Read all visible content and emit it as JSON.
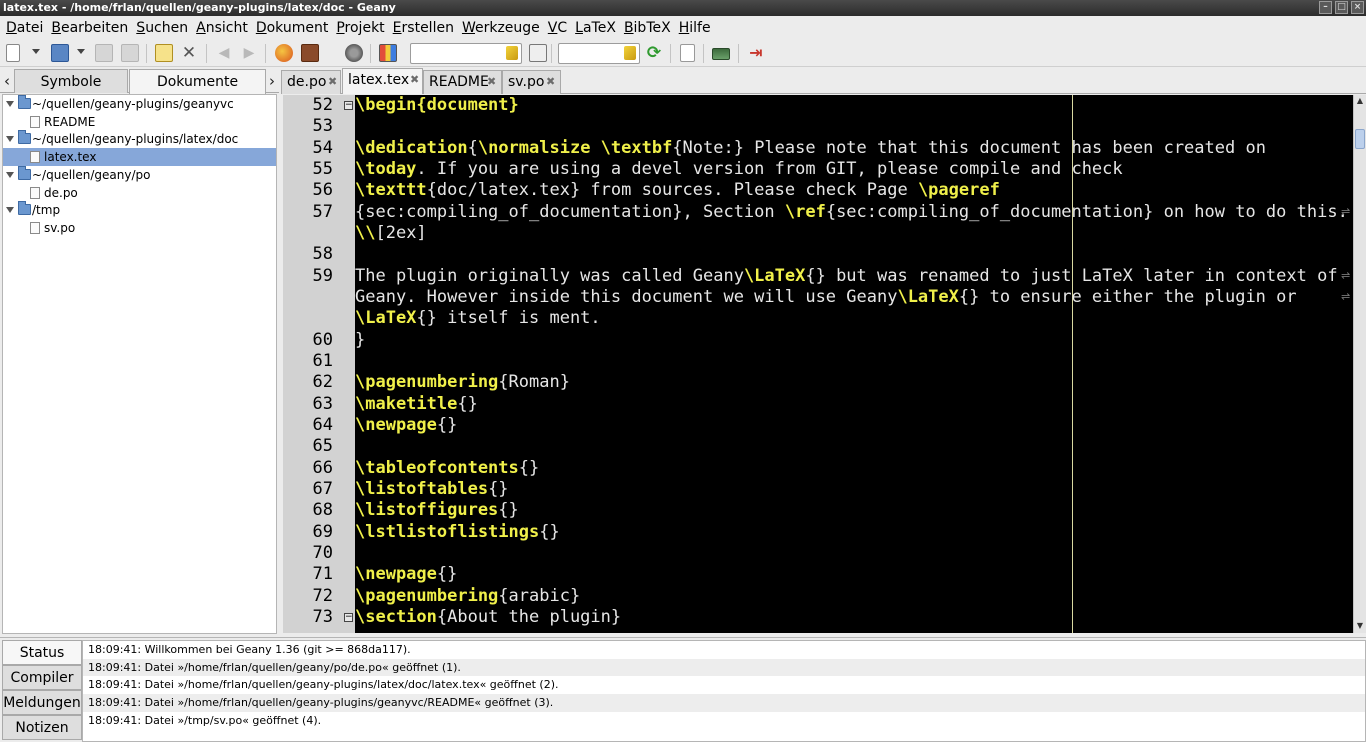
{
  "window": {
    "title": "latex.tex - /home/frlan/quellen/geany-plugins/latex/doc - Geany",
    "buttons": [
      "–",
      "□",
      "×"
    ]
  },
  "menu": [
    "Datei",
    "Bearbeiten",
    "Suchen",
    "Ansicht",
    "Dokument",
    "Projekt",
    "Erstellen",
    "Werkzeuge",
    "VC",
    "LaTeX",
    "BibTeX",
    "Hilfe"
  ],
  "toolbar": {
    "search_value": "",
    "goto_value": ""
  },
  "sidebar": {
    "tabs": [
      "Symbole",
      "Dokumente"
    ],
    "active_tab": "Dokumente",
    "tree": [
      {
        "type": "folder",
        "label": "~/quellen/geany-plugins/geanyvc"
      },
      {
        "type": "file",
        "label": "README"
      },
      {
        "type": "folder",
        "label": "~/quellen/geany-plugins/latex/doc"
      },
      {
        "type": "file",
        "label": "latex.tex",
        "selected": true
      },
      {
        "type": "folder",
        "label": "~/quellen/geany/po"
      },
      {
        "type": "file",
        "label": "de.po"
      },
      {
        "type": "folder",
        "label": "/tmp"
      },
      {
        "type": "file",
        "label": "sv.po"
      }
    ]
  },
  "editor_tabs": [
    {
      "label": "de.po"
    },
    {
      "label": "latex.tex",
      "active": true
    },
    {
      "label": "README"
    },
    {
      "label": "sv.po"
    }
  ],
  "editor": {
    "lines": [
      {
        "num": "52",
        "fold": true,
        "segs": [
          [
            "cmd",
            "\\begin{document}"
          ]
        ]
      },
      {
        "num": "53",
        "segs": []
      },
      {
        "num": "54",
        "segs": [
          [
            "cmd",
            "\\dedication"
          ],
          [
            "txt",
            "{"
          ],
          [
            "cmd",
            "\\normalsize \\textbf"
          ],
          [
            "txt",
            "{Note:} Please note that this document has been created on"
          ]
        ]
      },
      {
        "num": "55",
        "segs": [
          [
            "cmd",
            "\\today"
          ],
          [
            "txt",
            ". If you are using a devel version from GIT, please compile and check"
          ]
        ]
      },
      {
        "num": "56",
        "segs": [
          [
            "cmd",
            "\\texttt"
          ],
          [
            "txt",
            "{doc/latex.tex} from sources. Please check Page "
          ],
          [
            "cmd",
            "\\pageref"
          ]
        ]
      },
      {
        "num": "57",
        "segs": [
          [
            "txt",
            "{sec:compiling_of_documentation}, Section "
          ],
          [
            "cmd",
            "\\ref"
          ],
          [
            "txt",
            "{sec:compiling_of_documentation} on how to do this."
          ]
        ]
      },
      {
        "num": "",
        "segs": [
          [
            "cmd",
            "\\\\"
          ],
          [
            "txt",
            "[2ex]"
          ]
        ]
      },
      {
        "num": "58",
        "segs": []
      },
      {
        "num": "59",
        "segs": [
          [
            "txt",
            "The plugin originally was called Geany"
          ],
          [
            "cmd",
            "\\LaTeX"
          ],
          [
            "txt",
            "{} but was renamed to just LaTeX later in context of"
          ]
        ]
      },
      {
        "num": "",
        "segs": [
          [
            "txt",
            "Geany. However inside this document we will use Geany"
          ],
          [
            "cmd",
            "\\LaTeX"
          ],
          [
            "txt",
            "{} to ensure either the plugin or"
          ]
        ]
      },
      {
        "num": "",
        "segs": [
          [
            "cmd",
            "\\LaTeX"
          ],
          [
            "txt",
            "{} itself is ment."
          ]
        ]
      },
      {
        "num": "60",
        "segs": [
          [
            "txt",
            "}"
          ]
        ]
      },
      {
        "num": "61",
        "segs": []
      },
      {
        "num": "62",
        "segs": [
          [
            "cmd",
            "\\pagenumbering"
          ],
          [
            "txt",
            "{Roman}"
          ]
        ]
      },
      {
        "num": "63",
        "segs": [
          [
            "cmd",
            "\\maketitle"
          ],
          [
            "txt",
            "{}"
          ]
        ]
      },
      {
        "num": "64",
        "segs": [
          [
            "cmd",
            "\\newpage"
          ],
          [
            "txt",
            "{}"
          ]
        ]
      },
      {
        "num": "65",
        "segs": []
      },
      {
        "num": "66",
        "segs": [
          [
            "cmd",
            "\\tableofcontents"
          ],
          [
            "txt",
            "{}"
          ]
        ]
      },
      {
        "num": "67",
        "segs": [
          [
            "cmd",
            "\\listoftables"
          ],
          [
            "txt",
            "{}"
          ]
        ]
      },
      {
        "num": "68",
        "segs": [
          [
            "cmd",
            "\\listoffigures"
          ],
          [
            "txt",
            "{}"
          ]
        ]
      },
      {
        "num": "69",
        "segs": [
          [
            "cmd",
            "\\lstlistoflistings"
          ],
          [
            "txt",
            "{}"
          ]
        ]
      },
      {
        "num": "70",
        "segs": []
      },
      {
        "num": "71",
        "segs": [
          [
            "cmd",
            "\\newpage"
          ],
          [
            "txt",
            "{}"
          ]
        ]
      },
      {
        "num": "72",
        "segs": [
          [
            "cmd",
            "\\pagenumbering"
          ],
          [
            "txt",
            "{arabic}"
          ]
        ]
      },
      {
        "num": "73",
        "fold": true,
        "segs": [
          [
            "cmd",
            "\\section"
          ],
          [
            "txt",
            "{About the plugin}"
          ]
        ]
      }
    ]
  },
  "messages": {
    "tabs": [
      "Status",
      "Compiler",
      "Meldungen",
      "Notizen"
    ],
    "active_tab": "Status",
    "status": [
      "18:09:41: Willkommen bei Geany 1.36 (git >= 868da117).",
      "18:09:41: Datei »/home/frlan/quellen/geany/po/de.po« geöffnet (1).",
      "18:09:41: Datei »/home/frlan/quellen/geany-plugins/latex/doc/latex.tex« geöffnet (2).",
      "18:09:41: Datei »/home/frlan/quellen/geany-plugins/geanyvc/README« geöffnet (3).",
      "18:09:41: Datei »/tmp/sv.po« geöffnet (4)."
    ]
  },
  "colors": {
    "editor_bg": "#000000",
    "keyword": "#f0f04a",
    "text": "#e6e6e6",
    "selection": "#86a7d9"
  }
}
